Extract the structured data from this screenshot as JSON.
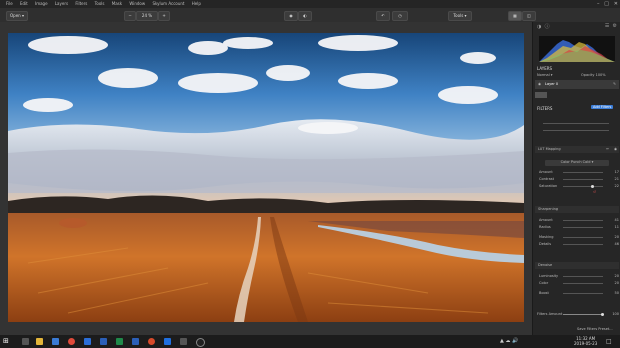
{
  "menu": {
    "items": [
      "File",
      "Edit",
      "Image",
      "Layers",
      "Filters",
      "Tools",
      "Mask",
      "Window",
      "Skylum Account",
      "Help"
    ]
  },
  "toolbar": {
    "open_label": "Open",
    "zoom_label": "24 %",
    "tools_label": "Tools"
  },
  "panel": {
    "layers_title": "LAYERS",
    "blend_mode": "Normal",
    "opacity_label": "Opacity",
    "opacity_value": "100%",
    "layer_name": "Layer 0",
    "filters_title": "FILTERS",
    "add_filters_label": "Add Filters",
    "lut_title": "LUT Mapping",
    "lut_selected": "Color Punch Cold",
    "lut_rows": [
      {
        "label": "Amount",
        "value": "17"
      },
      {
        "label": "Contrast",
        "value": "21"
      },
      {
        "label": "Saturation",
        "value": "22"
      }
    ],
    "sharpening_title": "Sharpening",
    "sharp_rows": [
      {
        "label": "Amount",
        "value": "41"
      },
      {
        "label": "Radius",
        "value": "11"
      },
      {
        "label": "Masking",
        "value": "20"
      },
      {
        "label": "Details",
        "value": "46"
      }
    ],
    "denoise_title": "Denoise",
    "denoise_rows": [
      {
        "label": "Luminosity",
        "value": "20"
      },
      {
        "label": "Color",
        "value": "20"
      },
      {
        "label": "Boost",
        "value": "50"
      }
    ],
    "filters_amount_label": "Filters Amount",
    "filters_amount_value": "100",
    "save_preset_label": "Save Filters Preset..."
  },
  "taskbar": {
    "time": "11:32 AM",
    "date": "2019-05-23"
  },
  "colors": {
    "sky_top": "#1d4f8a",
    "sky_mid": "#5f9cd3",
    "field": "#c8661d",
    "accent_blue": "#3b7dd8"
  }
}
